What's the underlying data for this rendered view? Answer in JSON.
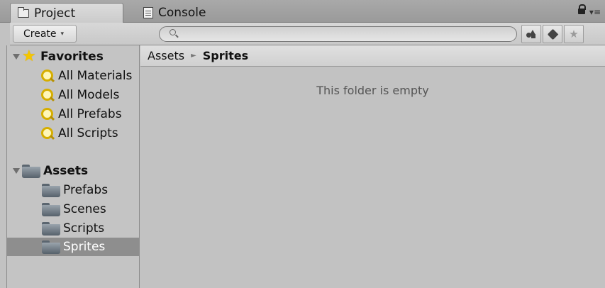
{
  "tabs": {
    "project": "Project",
    "console": "Console"
  },
  "toolbar": {
    "create_label": "Create",
    "create_caret": "▾",
    "search_value": "",
    "favorite_star": "★"
  },
  "favorites": {
    "header": "Favorites",
    "items": [
      {
        "label": "All Materials"
      },
      {
        "label": "All Models"
      },
      {
        "label": "All Prefabs"
      },
      {
        "label": "All Scripts"
      }
    ]
  },
  "assets": {
    "header": "Assets",
    "items": [
      {
        "label": "Prefabs"
      },
      {
        "label": "Scenes"
      },
      {
        "label": "Scripts"
      },
      {
        "label": "Sprites",
        "selected": true
      }
    ]
  },
  "breadcrumb": {
    "root": "Assets",
    "separator": "►",
    "current": "Sprites"
  },
  "main": {
    "empty_message": "This folder is empty"
  }
}
